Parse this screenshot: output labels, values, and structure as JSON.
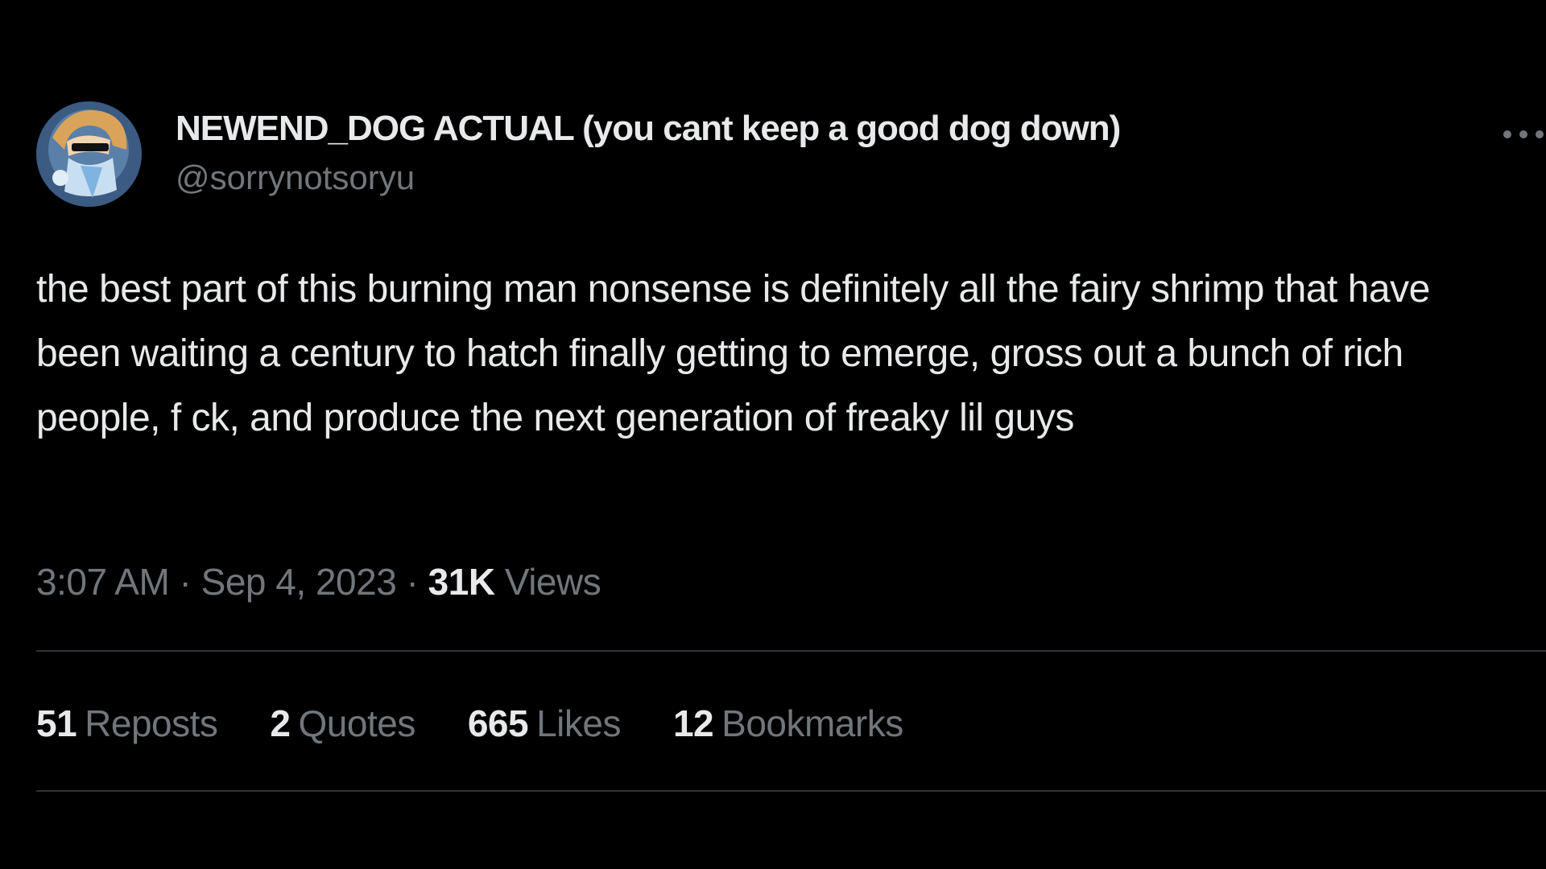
{
  "colors": {
    "background": "#000000",
    "primary_text": "#e7e9ea",
    "secondary_text": "#71767b",
    "divider": "#2f3336"
  },
  "author": {
    "display_name": "NEWEND_DOG ACTUAL (you cant keep a good dog down)",
    "handle": "@sorrynotsoryu",
    "avatar_icon": "avatar-illustration"
  },
  "more_icon": "more-horizontal-icon",
  "tweet": {
    "text": "the best part of this burning man nonsense is definitely all the fairy shrimp that have been waiting a century to hatch finally getting to emerge, gross out a bunch of rich people, f  ck, and produce the next generation of freaky lil guys"
  },
  "meta": {
    "time": "3:07 AM",
    "separator": " · ",
    "date": "Sep 4, 2023",
    "views_count": "31K",
    "views_label": "Views"
  },
  "stats": [
    {
      "count": "51",
      "label": "Reposts"
    },
    {
      "count": "2",
      "label": "Quotes"
    },
    {
      "count": "665",
      "label": "Likes"
    },
    {
      "count": "12",
      "label": "Bookmarks"
    }
  ]
}
